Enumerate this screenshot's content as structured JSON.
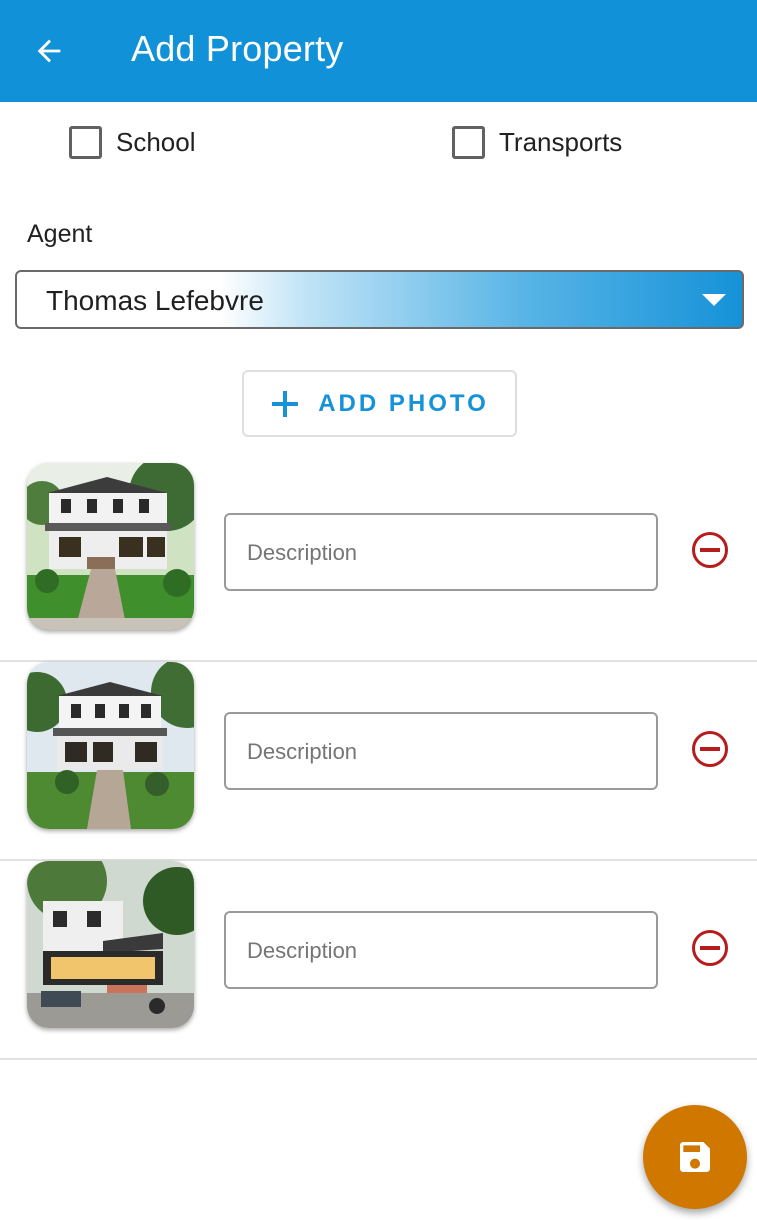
{
  "appbar": {
    "title": "Add Property",
    "back_icon": "arrow-left-icon",
    "color": "#1192d8"
  },
  "amenities": [
    {
      "label": "School",
      "checked": false
    },
    {
      "label": "Transports",
      "checked": false
    }
  ],
  "agent": {
    "label": "Agent",
    "selected": "Thomas Lefebvre"
  },
  "add_photo": {
    "label": "ADD PHOTO",
    "icon": "plus-icon",
    "color": "#1592d8"
  },
  "photos": [
    {
      "description_placeholder": "Description",
      "description_value": "",
      "remove_icon": "minus-circle-icon"
    },
    {
      "description_placeholder": "Description",
      "description_value": "",
      "remove_icon": "minus-circle-icon"
    },
    {
      "description_placeholder": "Description",
      "description_value": "",
      "remove_icon": "minus-circle-icon"
    }
  ],
  "fab": {
    "icon": "save-icon",
    "color": "#d07700"
  },
  "colors": {
    "remove": "#b71c1c"
  }
}
